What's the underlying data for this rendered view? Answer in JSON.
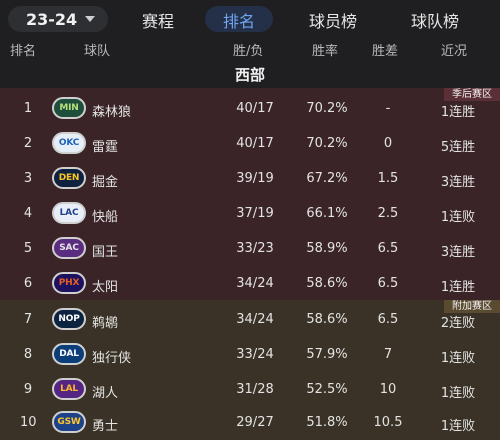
{
  "season": {
    "label": "23-24"
  },
  "tabs": [
    {
      "label": "赛程",
      "active": false
    },
    {
      "label": "排名",
      "active": true
    },
    {
      "label": "球员榜",
      "active": false
    },
    {
      "label": "球队榜",
      "active": false
    }
  ],
  "columns": {
    "rank": "排名",
    "team": "球队",
    "wl": "胜/负",
    "pct": "胜率",
    "gb": "胜差",
    "streak": "近况"
  },
  "conference": "西部",
  "zones": {
    "playoff": "季后赛区",
    "playin": "附加赛区"
  },
  "colors": {
    "accent": "#6fa4f0",
    "playoff_zone": "#3a2427",
    "playin_zone": "#3a3226"
  },
  "teams": [
    {
      "rank": "1",
      "logo": "MIN",
      "name": "森林狼",
      "wl": "40/17",
      "pct": "70.2%",
      "gb": "-",
      "streak": "1连胜"
    },
    {
      "rank": "2",
      "logo": "OKC",
      "name": "雷霆",
      "wl": "40/17",
      "pct": "70.2%",
      "gb": "0",
      "streak": "5连胜"
    },
    {
      "rank": "3",
      "logo": "DEN",
      "name": "掘金",
      "wl": "39/19",
      "pct": "67.2%",
      "gb": "1.5",
      "streak": "3连胜"
    },
    {
      "rank": "4",
      "logo": "LAC",
      "name": "快船",
      "wl": "37/19",
      "pct": "66.1%",
      "gb": "2.5",
      "streak": "1连败"
    },
    {
      "rank": "5",
      "logo": "SAC",
      "name": "国王",
      "wl": "33/23",
      "pct": "58.9%",
      "gb": "6.5",
      "streak": "3连胜"
    },
    {
      "rank": "6",
      "logo": "PHX",
      "name": "太阳",
      "wl": "34/24",
      "pct": "58.6%",
      "gb": "6.5",
      "streak": "1连胜"
    },
    {
      "rank": "7",
      "logo": "NOP",
      "name": "鹈鹕",
      "wl": "34/24",
      "pct": "58.6%",
      "gb": "6.5",
      "streak": "2连败"
    },
    {
      "rank": "8",
      "logo": "DAL",
      "name": "独行侠",
      "wl": "33/24",
      "pct": "57.9%",
      "gb": "7",
      "streak": "1连败"
    },
    {
      "rank": "9",
      "logo": "LAL",
      "name": "湖人",
      "wl": "31/28",
      "pct": "52.5%",
      "gb": "10",
      "streak": "1连败"
    },
    {
      "rank": "10",
      "logo": "GSW",
      "name": "勇士",
      "wl": "29/27",
      "pct": "51.8%",
      "gb": "10.5",
      "streak": "1连败"
    }
  ]
}
